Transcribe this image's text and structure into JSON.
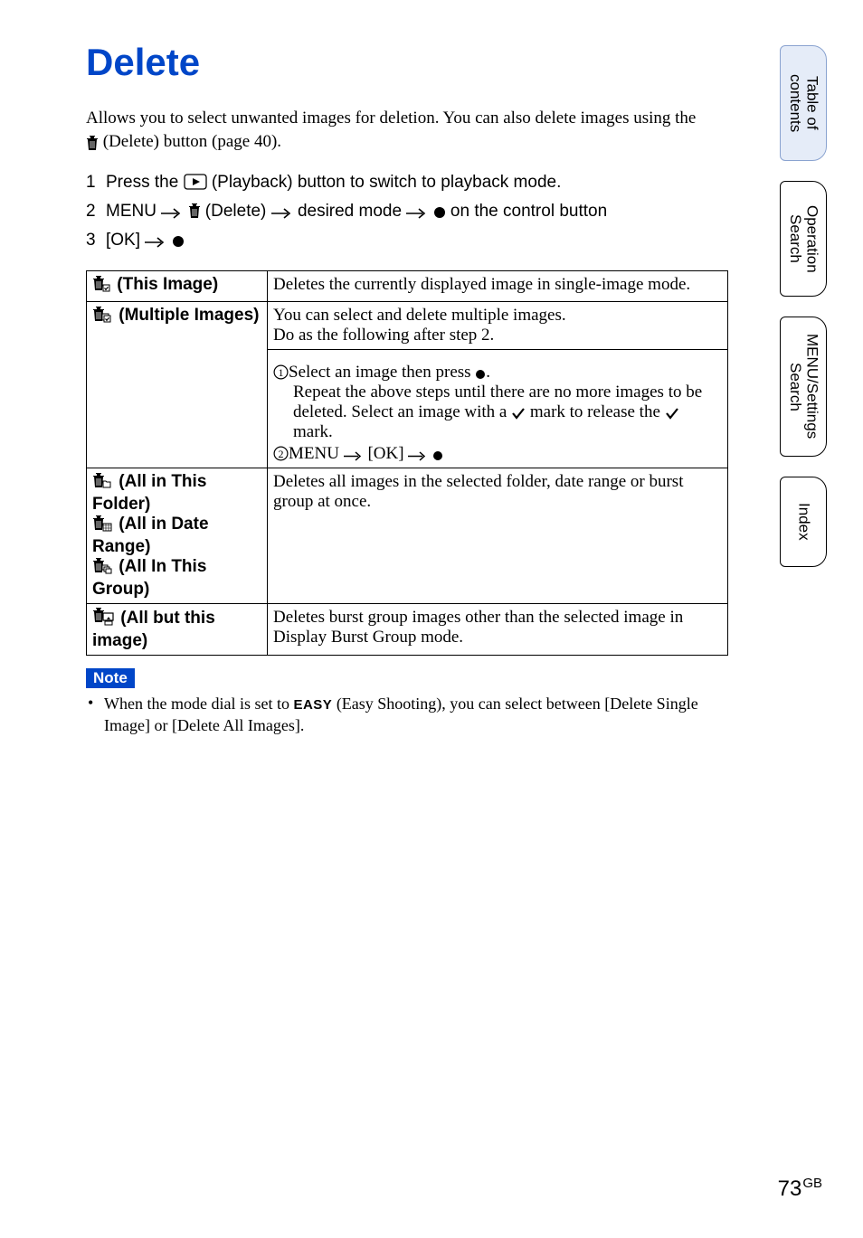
{
  "title": "Delete",
  "intro_line1": "Allows you to select unwanted images for deletion. You can also delete images using the",
  "intro_line2": " (Delete) button (page 40).",
  "steps": [
    {
      "num": "1",
      "pre": "Press the ",
      "post": " (Playback) button to switch to playback mode."
    },
    {
      "num": "2",
      "pre": "MENU ",
      "mid": " (Delete) ",
      "post": " desired mode ",
      "tail": " on the control button"
    },
    {
      "num": "3",
      "pre": "[OK] "
    }
  ],
  "table": {
    "row1": {
      "label": " (This Image)",
      "desc": "Deletes the currently displayed image in single-image mode."
    },
    "row2": {
      "label": " (Multiple Images)",
      "desc_a": "You can select and delete multiple images.",
      "desc_b": "Do as the following after step 2.",
      "step1_pre": "Select an image then press ",
      "step1_post": ".",
      "step1_repeat_a": "Repeat the above steps until there are no more images to be deleted. Select an image with a ",
      "step1_repeat_b": " mark to release the ",
      "step1_repeat_c": " mark.",
      "step2_pre": "MENU ",
      "step2_mid": " [OK] "
    },
    "row3": {
      "label1": " (All in This Folder)",
      "label2": " (All in Date Range)",
      "label3": " (All In This Group)",
      "desc": "Deletes all images in the selected folder, date range or burst group at once."
    },
    "row4": {
      "label": " (All but this image)",
      "desc": "Deletes burst group images other than the selected image in Display Burst Group mode."
    }
  },
  "note_label": "Note",
  "note_text_a": "When the mode dial is set to ",
  "note_easy": "EASY",
  "note_text_b": " (Easy Shooting), you can select between [Delete Single Image] or [Delete All Images].",
  "tabs": {
    "t1": "Table of\ncontents",
    "t2": "Operation\nSearch",
    "t3": "MENU/Settings\nSearch",
    "t4": "Index"
  },
  "page_number": "73",
  "page_suffix": "GB"
}
